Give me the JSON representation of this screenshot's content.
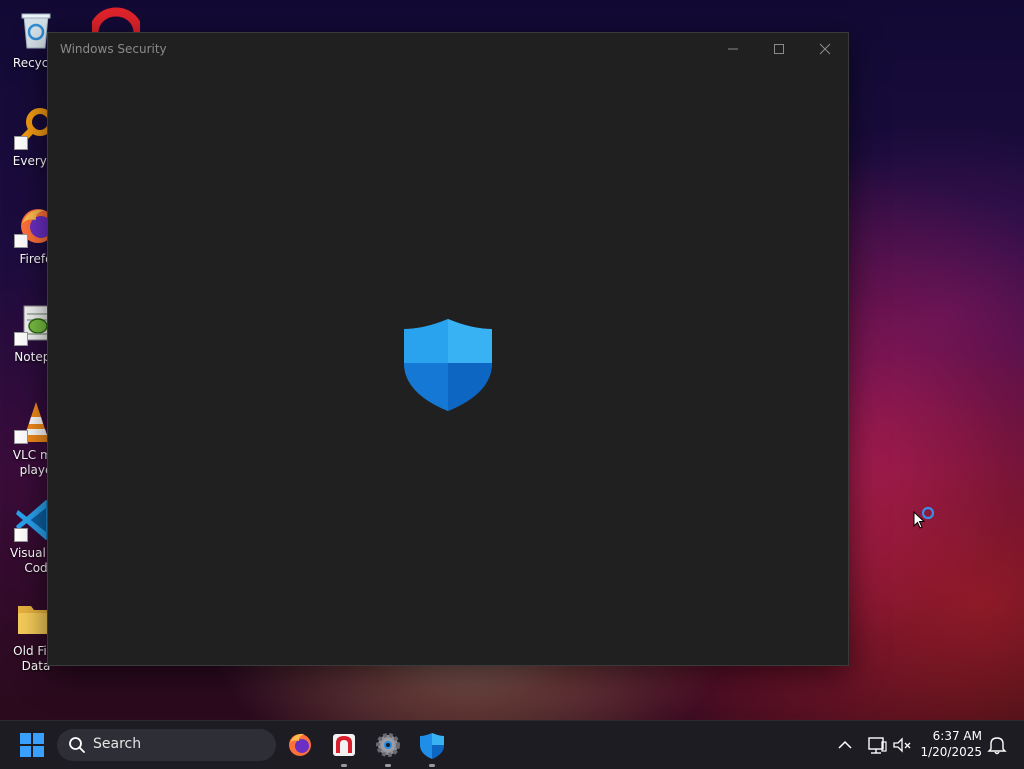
{
  "window": {
    "title": "Windows Security",
    "minimize_icon": "minimize-icon",
    "maximize_icon": "maximize-icon",
    "close_icon": "close-icon",
    "logo_icon": "windows-security-shield-icon"
  },
  "desktop": {
    "icons": [
      {
        "label": "Recycle",
        "icon": "recycle-bin-icon",
        "shortcut": false
      },
      {
        "label": "Everyth",
        "icon": "everything-search-icon",
        "shortcut": true
      },
      {
        "label": "Firefo",
        "icon": "firefox-icon",
        "shortcut": true
      },
      {
        "label": "Notepa",
        "icon": "notepad-plus-plus-icon",
        "shortcut": true
      },
      {
        "label": "VLC me playe",
        "icon": "vlc-icon",
        "shortcut": true
      },
      {
        "label": "Visual St Cod",
        "icon": "vscode-icon",
        "shortcut": true
      },
      {
        "label": "Old Fire Data",
        "icon": "folder-icon",
        "shortcut": false
      }
    ],
    "partial_icon": "opera-icon"
  },
  "taskbar": {
    "start_icon": "windows-start-icon",
    "search": {
      "label": "Search",
      "icon": "search-icon"
    },
    "pinned": [
      {
        "name": "firefox",
        "icon": "firefox-icon",
        "running": false
      },
      {
        "name": "app",
        "icon": "red-app-icon",
        "running": true
      },
      {
        "name": "settings",
        "icon": "settings-gear-icon",
        "running": true
      },
      {
        "name": "windows-security",
        "icon": "windows-security-shield-icon",
        "running": true
      }
    ],
    "tray": {
      "overflow_icon": "chevron-up-icon",
      "network_icon": "network-icon",
      "volume_icon": "volume-muted-icon",
      "notification_icon": "bell-icon"
    },
    "clock": {
      "time": "6:37 AM",
      "date": "1/20/2025"
    }
  },
  "colors": {
    "window_bg": "#202020",
    "taskbar_bg": "#1c1c22",
    "accent_blue": "#1f8ee8"
  }
}
